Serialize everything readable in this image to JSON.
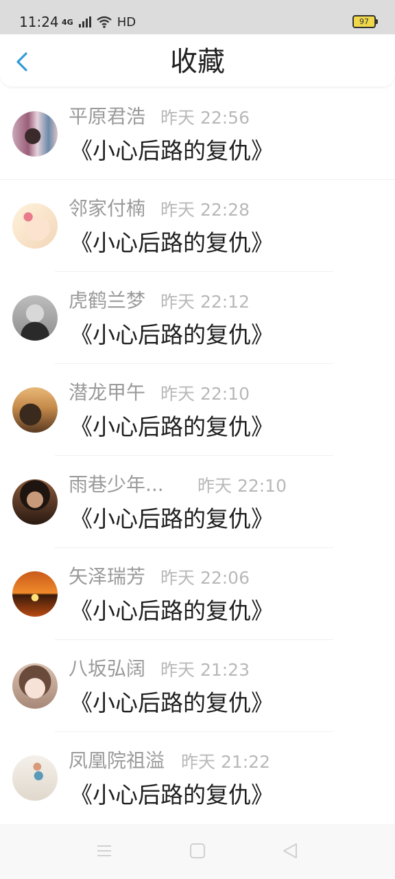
{
  "status_bar": {
    "time": "11:24",
    "network": "4G",
    "quality": "HD",
    "battery": "97"
  },
  "header": {
    "title": "收藏"
  },
  "items": [
    {
      "name": "平原君浩",
      "time": "昨天 22:56",
      "book": "《小心后路的复仇》"
    },
    {
      "name": "邻家付楠",
      "time": "昨天 22:28",
      "book": "《小心后路的复仇》"
    },
    {
      "name": "虎鹤兰梦",
      "time": "昨天 22:12",
      "book": "《小心后路的复仇》"
    },
    {
      "name": "潜龙甲午",
      "time": "昨天 22:10",
      "book": "《小心后路的复仇》"
    },
    {
      "name": "雨巷少年...",
      "time": "昨天 22:10",
      "book": "《小心后路的复仇》"
    },
    {
      "name": "矢泽瑞芳",
      "time": "昨天 22:06",
      "book": "《小心后路的复仇》"
    },
    {
      "name": "八坂弘阔",
      "time": "昨天 21:23",
      "book": "《小心后路的复仇》"
    },
    {
      "name": "凤凰院祖溢",
      "time": "昨天 21:22",
      "book": "《小心后路的复仇》"
    }
  ],
  "colors": {
    "accent": "#2f9ad8",
    "name": "#9a9a9a",
    "time": "#b8b8b8",
    "text": "#1e1e1e"
  }
}
